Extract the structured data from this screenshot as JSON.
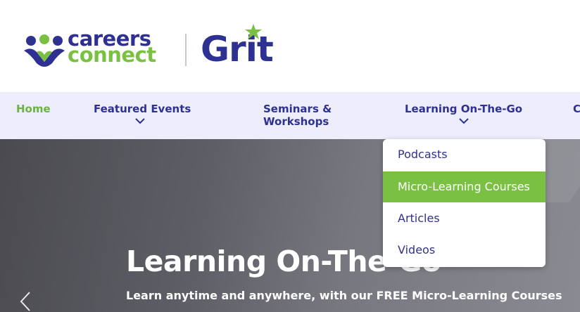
{
  "brand": {
    "cc_line1": "careers",
    "cc_line2": "connect",
    "grit": "Grit",
    "colors": {
      "navy": "#2e3192",
      "green": "#7ac143"
    }
  },
  "nav": {
    "items": [
      {
        "label": "Home",
        "active": true
      },
      {
        "label": "Featured Events",
        "has_dropdown": true
      },
      {
        "label": "Seminars & Workshops"
      },
      {
        "label": "Learning On-The-Go",
        "has_dropdown": true,
        "open": true
      },
      {
        "label": "C"
      }
    ]
  },
  "dropdown": {
    "items": [
      {
        "label": "Podcasts"
      },
      {
        "label": "Micro-Learning Courses",
        "highlighted": true
      },
      {
        "label": "Articles"
      },
      {
        "label": "Videos"
      }
    ]
  },
  "hero": {
    "title": "Learning On-The-Go",
    "subtitle": "Learn anytime and anywhere, with our FREE Micro-Learning Courses",
    "prev_icon": "chevron-left-icon"
  }
}
